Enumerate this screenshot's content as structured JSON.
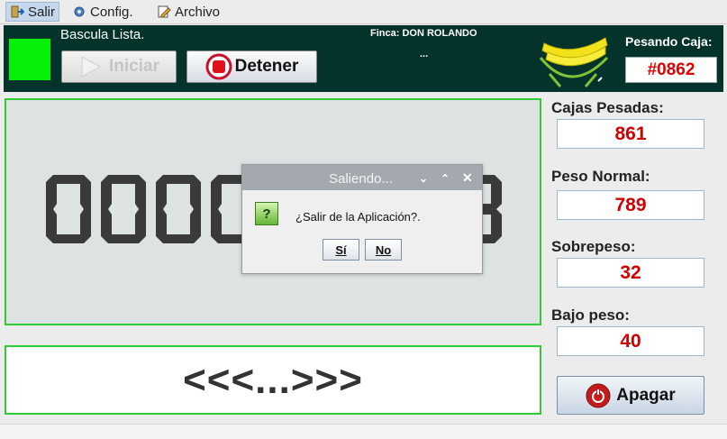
{
  "menu": {
    "items": [
      {
        "label": "Salir",
        "icon": "exit-icon"
      },
      {
        "label": "Config.",
        "icon": "gear-icon"
      },
      {
        "label": "Archivo",
        "icon": "file-edit-icon"
      }
    ]
  },
  "header": {
    "status": "Bascula Lista.",
    "start_label": "Iniciar",
    "stop_label": "Detener",
    "farm": "Finca: DON ROLANDO",
    "farm_value": "...",
    "weighing_label": "Pesando Caja:",
    "weighing_value": "#0862",
    "led_color": "#06f007"
  },
  "display": {
    "visible_digits": [
      "0",
      "0",
      "0",
      "0",
      "3"
    ],
    "arrows": "<<<...>>>"
  },
  "stats": {
    "boxes_label": "Cajas Pesadas:",
    "boxes_value": "861",
    "normal_label": "Peso Normal:",
    "normal_value": "789",
    "over_label": "Sobrepeso:",
    "over_value": "32",
    "under_label": "Bajo peso:",
    "under_value": "40",
    "power_label": "Apagar"
  },
  "dialog": {
    "title": "Saliendo...",
    "message": "¿Salir de la Aplicación?.",
    "yes": "Sí",
    "no": "No"
  },
  "colors": {
    "header_bg": "#03332a",
    "border_green": "#2fcc33",
    "value_red": "#d00000"
  }
}
